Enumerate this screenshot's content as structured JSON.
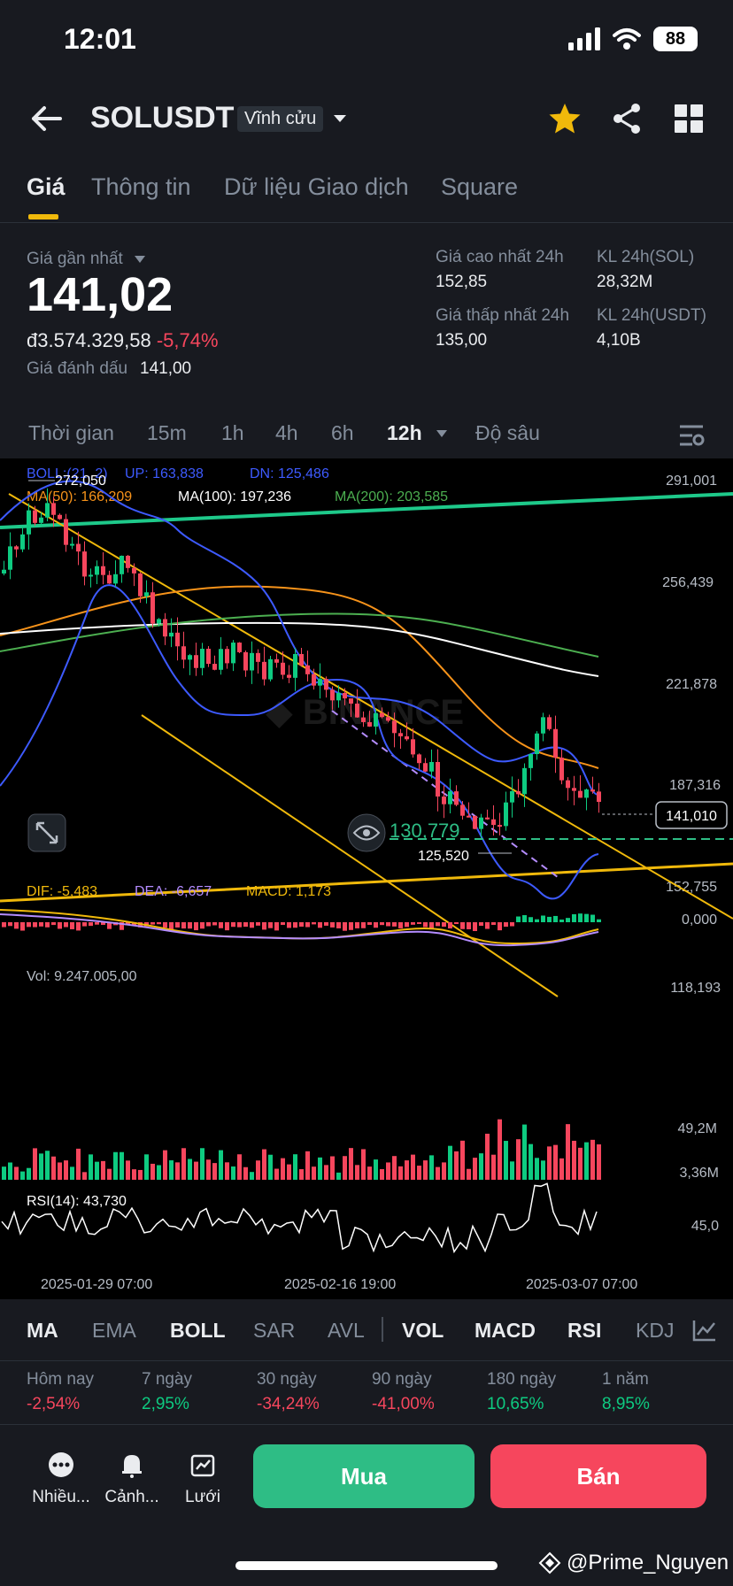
{
  "status": {
    "time": "12:01",
    "battery": "88"
  },
  "header": {
    "symbol": "SOLUSDT",
    "contract_type": "Vĩnh cửu"
  },
  "tabs": [
    "Giá",
    "Thông tin",
    "Dữ liệu Giao dịch",
    "Square"
  ],
  "price": {
    "last_label": "Giá gần nhất",
    "last_value": "141,02",
    "vnd_value": "đ3.574.329,58",
    "change_pct": "-5,74%",
    "mark_label": "Giá đánh dấu",
    "mark_value": "141,00",
    "high_label": "Giá cao nhất 24h",
    "high_value": "152,85",
    "low_label": "Giá thấp nhất 24h",
    "low_value": "135,00",
    "vol_sol_label": "KL 24h(SOL)",
    "vol_sol_value": "28,32M",
    "vol_usdt_label": "KL 24h(USDT)",
    "vol_usdt_value": "4,10B"
  },
  "intervals": [
    "Thời gian",
    "15m",
    "1h",
    "4h",
    "6h",
    "12h",
    "Độ sâu"
  ],
  "active_interval": "12h",
  "indicators": {
    "boll": "BOLL:(21, 2)",
    "boll_up": "UP: 163,838",
    "boll_dn": "DN: 125,486",
    "ma50": "MA(50): 166,209",
    "ma100": "MA(100): 197,236",
    "ma200": "MA(200): 203,585",
    "dif": "DIF: -5,483",
    "dea": "DEA: -6,657",
    "macd": "MACD: 1,173",
    "vol": "Vol: 9.247.005,00",
    "rsi": "RSI(14): 43,730"
  },
  "chart_labels": {
    "high_marker": "272,050",
    "low_marker": "125,520",
    "support_level": "130,779",
    "current_price_tag": "141,010",
    "price_axis": [
      "291,001",
      "256,439",
      "221,878",
      "187,316",
      "152,755",
      "118,193"
    ],
    "macd_axis": "0,000",
    "vol_axis": [
      "49,2M",
      "3,36M"
    ],
    "rsi_axis": "45,0",
    "dates": [
      "2025-01-29 07:00",
      "2025-02-16 19:00",
      "2025-03-07 07:00"
    ]
  },
  "colors": {
    "up": "#0ecb81",
    "down": "#f6465d",
    "accent": "#f0b90b",
    "boll": "#3d5afe",
    "ma50": "#f7931a",
    "ma100": "#ffffff",
    "ma200": "#4caf50"
  },
  "indicator_tabs": [
    "MA",
    "EMA",
    "BOLL",
    "SAR",
    "AVL",
    "VOL",
    "MACD",
    "RSI",
    "KDJ"
  ],
  "performance": [
    {
      "label": "Hôm nay",
      "value": "-2,54%"
    },
    {
      "label": "7 ngày",
      "value": "2,95%"
    },
    {
      "label": "30 ngày",
      "value": "-34,24%"
    },
    {
      "label": "90 ngày",
      "value": "-41,00%"
    },
    {
      "label": "180 ngày",
      "value": "10,65%"
    },
    {
      "label": "1 năm",
      "value": "8,95%"
    }
  ],
  "bottom_bar": {
    "more": "Nhiều...",
    "alert": "Cảnh...",
    "grid": "Lưới",
    "buy": "Mua",
    "sell": "Bán"
  },
  "watermark": "@Prime_Nguyen"
}
